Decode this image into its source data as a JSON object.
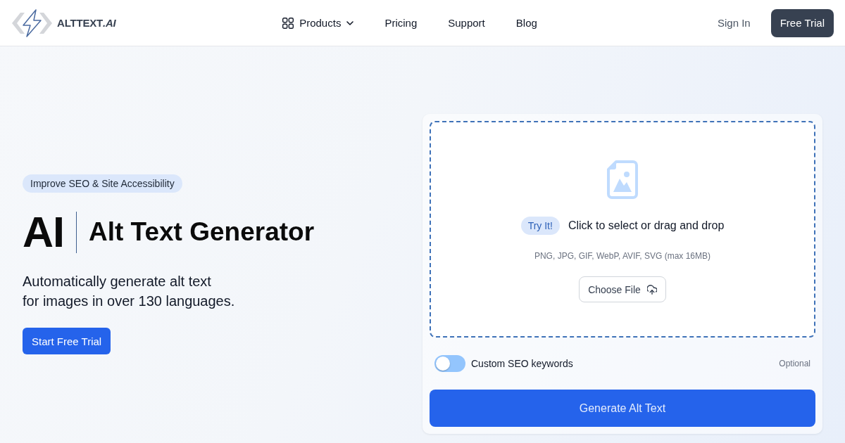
{
  "header": {
    "logo": {
      "name": "ALTTEXT",
      "suffix": ".AI"
    },
    "nav": [
      {
        "label": "Products",
        "kind": "menu"
      },
      {
        "label": "Pricing",
        "kind": "link"
      },
      {
        "label": "Support",
        "kind": "link"
      },
      {
        "label": "Blog",
        "kind": "link"
      }
    ],
    "sign_in": "Sign In",
    "cta": "Free Trial"
  },
  "hero": {
    "badge": "Improve SEO & Site Accessibility",
    "title_short": "AI",
    "title": "Alt Text Generator",
    "subtitle_lines": [
      "Automatically generate alt text",
      "for images in over 130 languages."
    ],
    "cta": "Start Free Trial"
  },
  "uploader": {
    "try_badge": "Try It!",
    "prompt": "Click to select or drag and drop",
    "formats": "PNG, JPG, GIF, WebP, AVIF, SVG (max 16MB)",
    "choose_button": "Choose File",
    "keywords_toggle": {
      "label": "Custom SEO keywords",
      "on": false,
      "note": "Optional"
    },
    "generate_button": "Generate Alt Text"
  }
}
